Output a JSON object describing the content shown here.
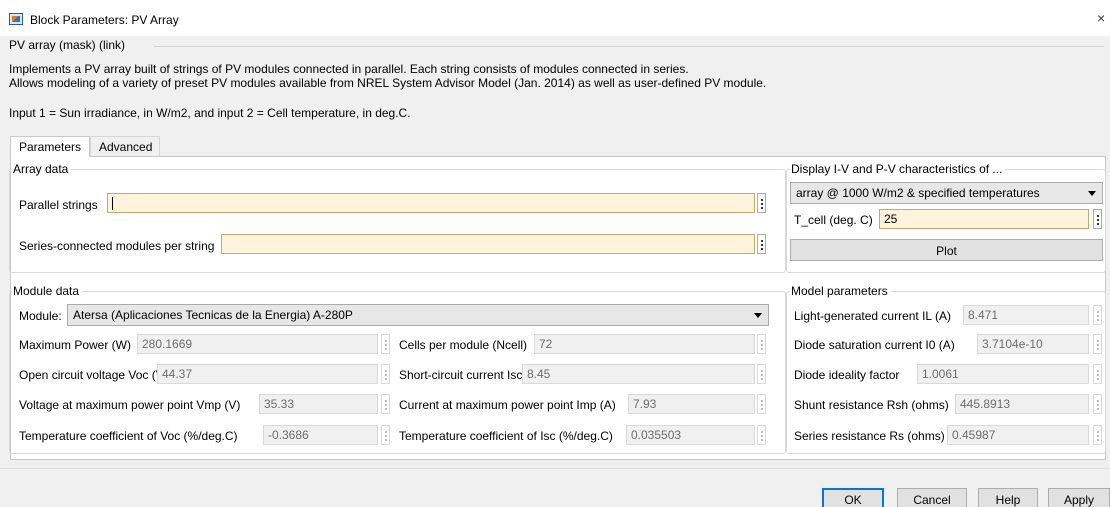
{
  "window": {
    "title": "Block Parameters: PV Array",
    "close_glyph": "×"
  },
  "mask": {
    "title": "PV array (mask) (link)",
    "description_line1": "Implements a PV array built of strings of PV modules connected in parallel. Each string consists of modules connected in series.",
    "description_line2": "Allows modeling of a variety of preset PV modules available from NREL System Advisor Model (Jan. 2014) as well as user-defined PV module.",
    "description_line3": "Input 1 = Sun irradiance, in W/m2, and input 2 = Cell temperature, in deg.C."
  },
  "tabs": [
    {
      "label": "Parameters",
      "active": true
    },
    {
      "label": "Advanced",
      "active": false
    }
  ],
  "array_data": {
    "legend": "Array data",
    "parallel_strings": {
      "label": "Parallel strings",
      "value": ""
    },
    "series_modules": {
      "label": "Series-connected modules per string",
      "value": ""
    }
  },
  "display": {
    "legend": "Display  I-V and P-V characteristics of ...",
    "selected": "array @ 1000 W/m2 & specified temperatures",
    "tcell_label": "T_cell (deg. C)",
    "tcell_value": "25",
    "plot_label": "Plot"
  },
  "module_data": {
    "legend": "Module data",
    "module_label": "Module:",
    "module_selected": "Atersa (Aplicaciones Tecnicas de la Energia) A-280P",
    "left": [
      {
        "label": "Maximum Power (W)",
        "value": "280.1669"
      },
      {
        "label": "Open circuit voltage  Voc (V)",
        "value": "44.37"
      },
      {
        "label": "Voltage at maximum power point Vmp (V)",
        "value": "35.33"
      },
      {
        "label": "Temperature coefficient of Voc (%/deg.C)",
        "value": "-0.3686"
      }
    ],
    "right": [
      {
        "label": "Cells per module (Ncell)",
        "value": "72"
      },
      {
        "label": "Short-circuit current Isc (A)",
        "value": "8.45"
      },
      {
        "label": "Current at maximum power point Imp (A)",
        "value": "7.93"
      },
      {
        "label": "Temperature coefficient of Isc (%/deg.C)",
        "value": "0.035503"
      }
    ]
  },
  "model_params": {
    "legend": "Model parameters",
    "items": [
      {
        "label": "Light-generated current IL (A)",
        "value": "8.471"
      },
      {
        "label": "Diode saturation current I0 (A)",
        "value": "3.7104e-10"
      },
      {
        "label": "Diode ideality factor",
        "value": "1.0061"
      },
      {
        "label": "Shunt resistance Rsh (ohms)",
        "value": "445.8913"
      },
      {
        "label": "Series resistance Rs (ohms)",
        "value": "0.45987"
      }
    ]
  },
  "buttons": {
    "ok": "OK",
    "cancel": "Cancel",
    "help": "Help",
    "apply": "Apply"
  },
  "colors": {
    "field_yellow": "#fff3dc",
    "focus_blue": "#0078d7",
    "panel_bg": "#f0f0f0"
  }
}
